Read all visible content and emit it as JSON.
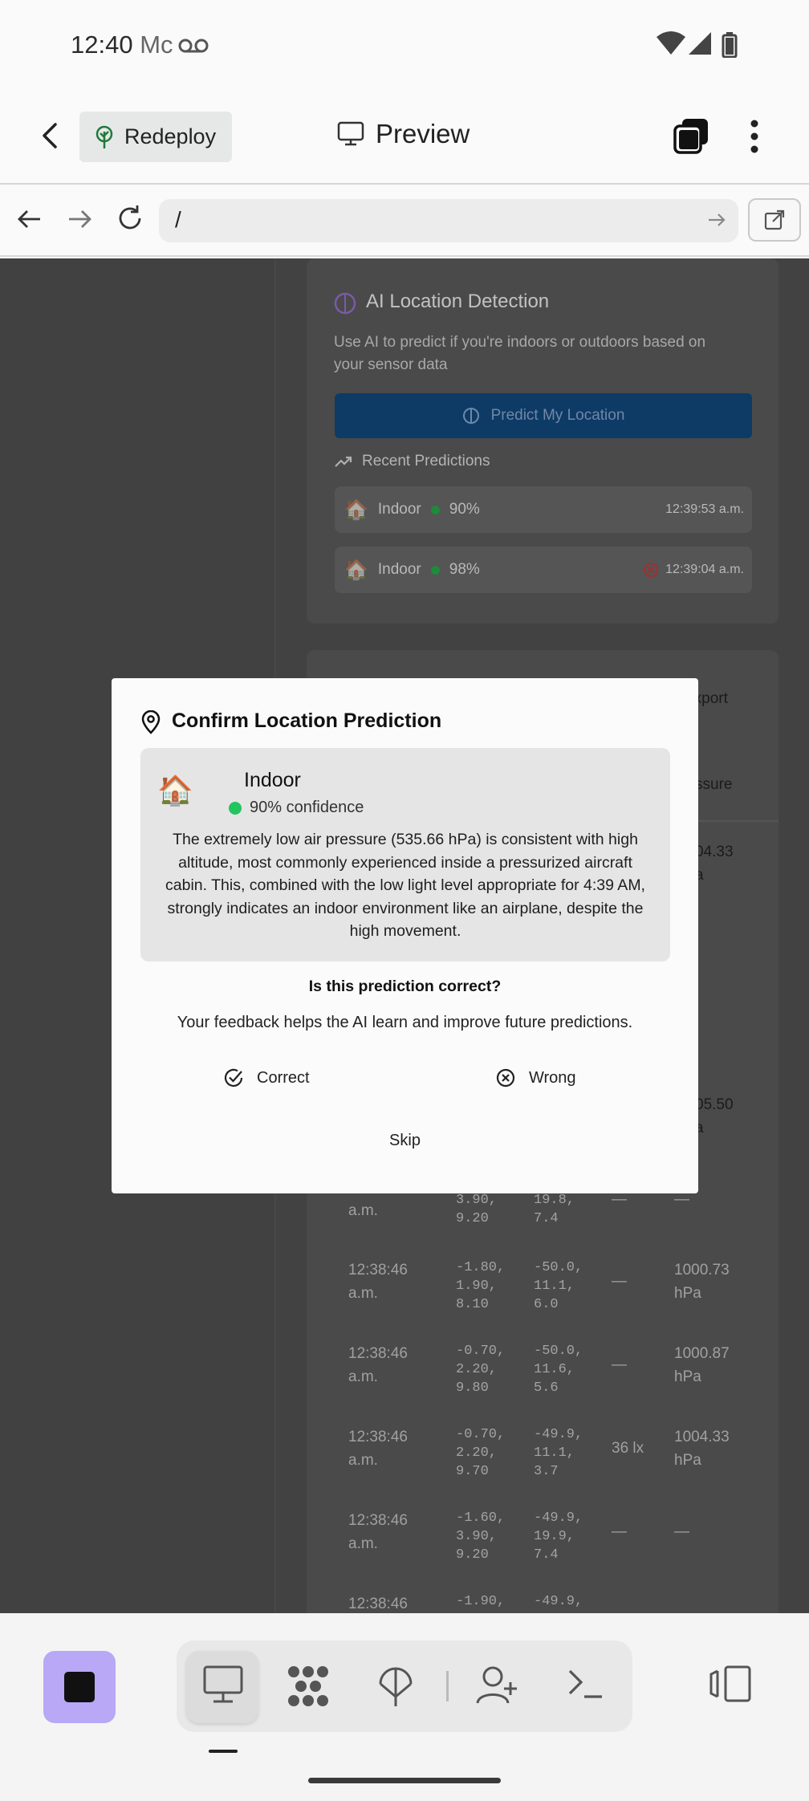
{
  "status_bar": {
    "time": "12:40",
    "carrier_fragment": "Mc"
  },
  "app_bar": {
    "redeploy_label": "Redeploy",
    "title": "Preview"
  },
  "url_bar": {
    "url": "/"
  },
  "page": {
    "ai_card": {
      "title": "AI Location Detection",
      "description_line1": "Use AI to predict if you're indoors or outdoors based on",
      "description_line2": "your sensor data",
      "predict_button": "Predict My Location",
      "recent_label": "Recent Predictions",
      "recent": [
        {
          "label": "Indoor",
          "confidence": "90%",
          "time": "12:39:53 a.m."
        },
        {
          "label": "Indoor",
          "confidence": "98%",
          "time": "12:39:04 a.m."
        }
      ]
    },
    "table": {
      "export_label": "Export",
      "pressure_header": "ssure",
      "partial_pressures": [
        {
          "value": "04.33",
          "unit": "a"
        },
        {
          "value": "05.50",
          "unit": "a"
        }
      ],
      "rows": [
        {
          "time": "a.m.",
          "accel": "3.90,\n9.20",
          "mag": "19.8,\n7.4",
          "light": "—",
          "pressure": "—"
        },
        {
          "time": "12:38:46\na.m.",
          "accel": "-1.80,\n1.90,\n8.10",
          "mag": "-50.0,\n11.1,\n6.0",
          "light": "—",
          "pressure": "1000.73\nhPa"
        },
        {
          "time": "12:38:46\na.m.",
          "accel": "-0.70,\n2.20,\n9.80",
          "mag": "-50.0,\n11.6,\n5.6",
          "light": "—",
          "pressure": "1000.87\nhPa"
        },
        {
          "time": "12:38:46\na.m.",
          "accel": "-0.70,\n2.20,\n9.70",
          "mag": "-49.9,\n11.1,\n3.7",
          "light": "36 lx",
          "pressure": "1004.33\nhPa"
        },
        {
          "time": "12:38:46\na.m.",
          "accel": "-1.60,\n3.90,\n9.20",
          "mag": "-49.9,\n19.9,\n7.4",
          "light": "—",
          "pressure": "—"
        },
        {
          "time": "12:38:46",
          "accel": "-1.90,",
          "mag": "-49.9,",
          "light": "",
          "pressure": ""
        }
      ]
    }
  },
  "dialog": {
    "title": "Confirm Location Prediction",
    "prediction": "Indoor",
    "prediction_emoji": "🏠",
    "confidence": "90% confidence",
    "reasoning": "The extremely low air pressure (535.66 hPa) is consistent with high altitude, most commonly experienced inside a pressurized aircraft cabin. This, combined with the low light level appropriate for 4:39 AM, strongly indicates an indoor environment like an airplane, despite the high movement.",
    "question": "Is this prediction correct?",
    "feedback": "Your feedback helps the AI learn and improve future predictions.",
    "correct_label": "Correct",
    "wrong_label": "Wrong",
    "skip_label": "Skip"
  },
  "colors": {
    "accent": "#b9a8f5",
    "confidence_dot": "#22c55e",
    "predict_button": "#0e3a66"
  }
}
